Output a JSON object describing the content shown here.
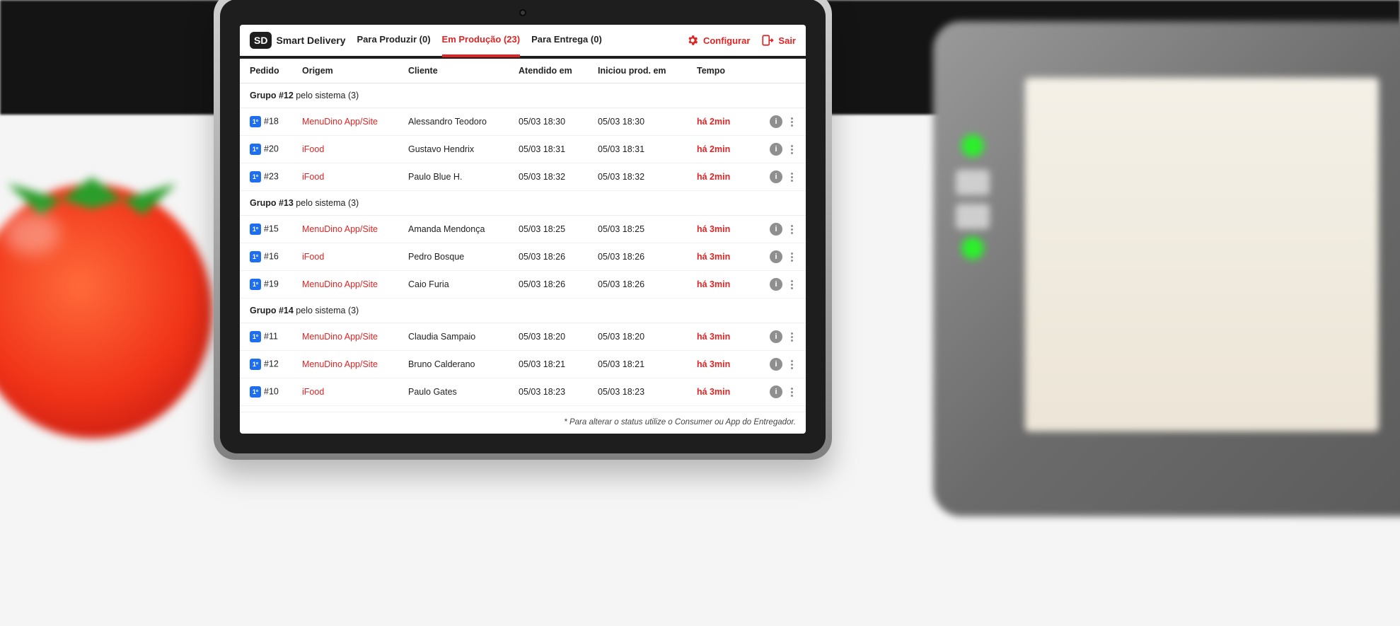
{
  "app": {
    "logo_short": "SD",
    "title": "Smart Delivery"
  },
  "tabs": [
    {
      "label": "Para Produzir (0)",
      "active": false
    },
    {
      "label": "Em Produção (23)",
      "active": true
    },
    {
      "label": "Para Entrega (0)",
      "active": false
    }
  ],
  "header_actions": {
    "configure": "Configurar",
    "logout": "Sair"
  },
  "columns": {
    "pedido": "Pedido",
    "origem": "Origem",
    "cliente": "Cliente",
    "atendido": "Atendido em",
    "prod": "Iniciou prod. em",
    "tempo": "Tempo"
  },
  "badge_text": "1º",
  "groups": [
    {
      "title_prefix": "Grupo #12",
      "title_suffix": " pelo sistema (3)",
      "rows": [
        {
          "pedido": "#18",
          "origem": "MenuDino App/Site",
          "cliente": "Alessandro Teodoro",
          "atendido": "05/03 18:30",
          "prod": "05/03 18:30",
          "tempo": "há 2min"
        },
        {
          "pedido": "#20",
          "origem": "iFood",
          "cliente": "Gustavo Hendrix",
          "atendido": "05/03 18:31",
          "prod": "05/03 18:31",
          "tempo": "há 2min"
        },
        {
          "pedido": "#23",
          "origem": "iFood",
          "cliente": "Paulo Blue H.",
          "atendido": "05/03 18:32",
          "prod": "05/03 18:32",
          "tempo": "há 2min"
        }
      ]
    },
    {
      "title_prefix": "Grupo #13",
      "title_suffix": " pelo sistema (3)",
      "rows": [
        {
          "pedido": "#15",
          "origem": "MenuDino App/Site",
          "cliente": "Amanda Mendonça",
          "atendido": "05/03 18:25",
          "prod": "05/03 18:25",
          "tempo": "há 3min"
        },
        {
          "pedido": "#16",
          "origem": "iFood",
          "cliente": "Pedro Bosque",
          "atendido": "05/03 18:26",
          "prod": "05/03 18:26",
          "tempo": "há 3min"
        },
        {
          "pedido": "#19",
          "origem": "MenuDino App/Site",
          "cliente": "Caio Furia",
          "atendido": "05/03 18:26",
          "prod": "05/03 18:26",
          "tempo": "há 3min"
        }
      ]
    },
    {
      "title_prefix": "Grupo #14",
      "title_suffix": " pelo sistema (3)",
      "rows": [
        {
          "pedido": "#11",
          "origem": "MenuDino App/Site",
          "cliente": "Claudia Sampaio",
          "atendido": "05/03 18:20",
          "prod": "05/03 18:20",
          "tempo": "há 3min"
        },
        {
          "pedido": "#12",
          "origem": "MenuDino App/Site",
          "cliente": "Bruno Calderano",
          "atendido": "05/03 18:21",
          "prod": "05/03 18:21",
          "tempo": "há 3min"
        },
        {
          "pedido": "#10",
          "origem": "iFood",
          "cliente": "Paulo Gates",
          "atendido": "05/03 18:23",
          "prod": "05/03 18:23",
          "tempo": "há 3min"
        }
      ]
    }
  ],
  "footer_note": "* Para alterar o status utilize o Consumer ou App do Entregador."
}
